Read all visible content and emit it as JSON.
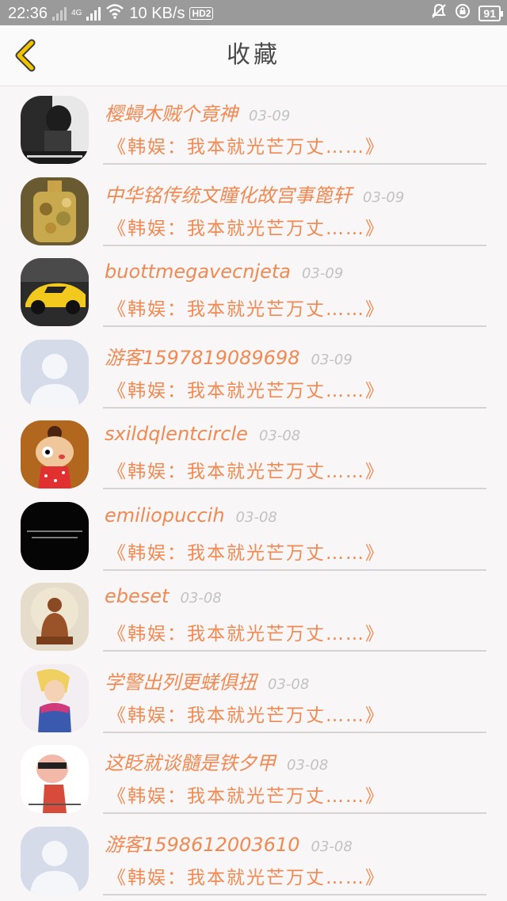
{
  "status_bar": {
    "time": "22:36",
    "network_speed": "10 KB/s",
    "signal_label": "4G",
    "hd_label": "HD2",
    "battery": "91"
  },
  "header": {
    "title": "收藏"
  },
  "items": [
    {
      "name": "樱蟳木贼个竟神",
      "date": "03-09",
      "subtitle": "《韩娱：我本就光芒万丈……》",
      "avatar": "dark-photo"
    },
    {
      "name": "中华铭传统文瞳化故宫事篦轩",
      "date": "03-09",
      "subtitle": "《韩娱：我本就光芒万丈……》",
      "avatar": "perfume-bottle"
    },
    {
      "name": "buottmegavecnjeta",
      "date": "03-09",
      "subtitle": "《韩娱：我本就光芒万丈……》",
      "avatar": "yellow-car"
    },
    {
      "name": "游客1597819089698",
      "date": "03-09",
      "subtitle": "《韩娱：我本就光芒万丈……》",
      "avatar": "default-person"
    },
    {
      "name": "sxildqlentcircle",
      "date": "03-08",
      "subtitle": "《韩娱：我本就光芒万丈……》",
      "avatar": "cartoon-girl"
    },
    {
      "name": "emiliopuccih",
      "date": "03-08",
      "subtitle": "《韩娱：我本就光芒万丈……》",
      "avatar": "black-text"
    },
    {
      "name": "ebeset",
      "date": "03-08",
      "subtitle": "《韩娱：我本就光芒万丈……》",
      "avatar": "buddha-statue"
    },
    {
      "name": "学警出列更蜣俱扭",
      "date": "03-08",
      "subtitle": "《韩娱：我本就光芒万丈……》",
      "avatar": "anime-character"
    },
    {
      "name": "这眨就谈髓是铁夕甲",
      "date": "03-08",
      "subtitle": "《韩娱：我本就光芒万丈……》",
      "avatar": "cartoon-meme"
    },
    {
      "name": "游客1598612003610",
      "date": "03-08",
      "subtitle": "《韩娱：我本就光芒万丈……》",
      "avatar": "default-person"
    }
  ],
  "colors": {
    "accent": "#f08a52",
    "back_icon": "#f2c400"
  }
}
